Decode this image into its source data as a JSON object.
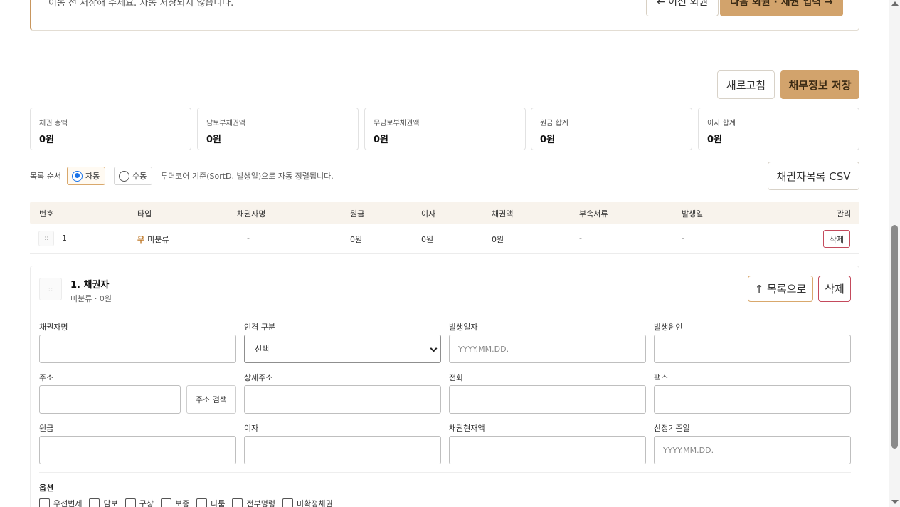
{
  "notice": {
    "text": "이동 전 저장해 주세요. 자동 저장되지 않습니다.",
    "prev_round_label": "← 이전 회원",
    "next_round_label": "다음 회원 · 채권 입력 →"
  },
  "actions": {
    "refresh_label": "새로고침",
    "save_label": "채무정보 저장"
  },
  "summary": [
    {
      "label": "채권 총액",
      "value": "0원"
    },
    {
      "label": "담보부채권액",
      "value": "0원"
    },
    {
      "label": "무담보부채권액",
      "value": "0원"
    },
    {
      "label": "원금 합계",
      "value": "0원"
    },
    {
      "label": "이자 합계",
      "value": "0원"
    }
  ],
  "sort": {
    "label": "목록 순서",
    "options": [
      "자동",
      "수동"
    ],
    "selected": "자동",
    "description": "투더코어 기준(SortD, 발생일)으로 자동 정렬됩니다.",
    "csv_label": "채권자목록 CSV"
  },
  "table": {
    "headers": [
      "번호",
      "타입",
      "채권자명",
      "원금",
      "이자",
      "채권액",
      "부속서류",
      "발생일",
      "관리"
    ],
    "rows": [
      {
        "handle": "::",
        "no": "1",
        "type_icon": "우",
        "type": "미분류",
        "name": "-",
        "principal": "0원",
        "interest": "0원",
        "amount": "0원",
        "docs": "-",
        "date": "-",
        "action": "삭제"
      }
    ]
  },
  "detail": {
    "handle": "::",
    "title": "1. 채권자",
    "subtitle": "미분류 · 0원",
    "to_list_label": "↑ 목록으로",
    "delete_label": "삭제",
    "fields": {
      "creditor_name": {
        "label": "채권자명",
        "value": ""
      },
      "person_type": {
        "label": "인격 구분",
        "value": "선택"
      },
      "occur_date": {
        "label": "발생일자",
        "placeholder": "YYYY.MM.DD."
      },
      "occur_cause": {
        "label": "발생원인",
        "value": ""
      },
      "address": {
        "label": "주소",
        "value": "",
        "search_label": "주소 검색"
      },
      "address_detail": {
        "label": "상세주소",
        "value": ""
      },
      "phone": {
        "label": "전화",
        "value": ""
      },
      "fax": {
        "label": "팩스",
        "value": ""
      },
      "principal": {
        "label": "원금",
        "value": ""
      },
      "interest": {
        "label": "이자",
        "value": ""
      },
      "current_amount": {
        "label": "채권현재액",
        "value": ""
      },
      "calc_date": {
        "label": "산정기준일",
        "placeholder": "YYYY.MM.DD."
      }
    },
    "options_label": "옵션",
    "options": [
      "우선변제",
      "담보",
      "구상",
      "보증",
      "다툼",
      "전부명령",
      "미확정채권"
    ]
  }
}
